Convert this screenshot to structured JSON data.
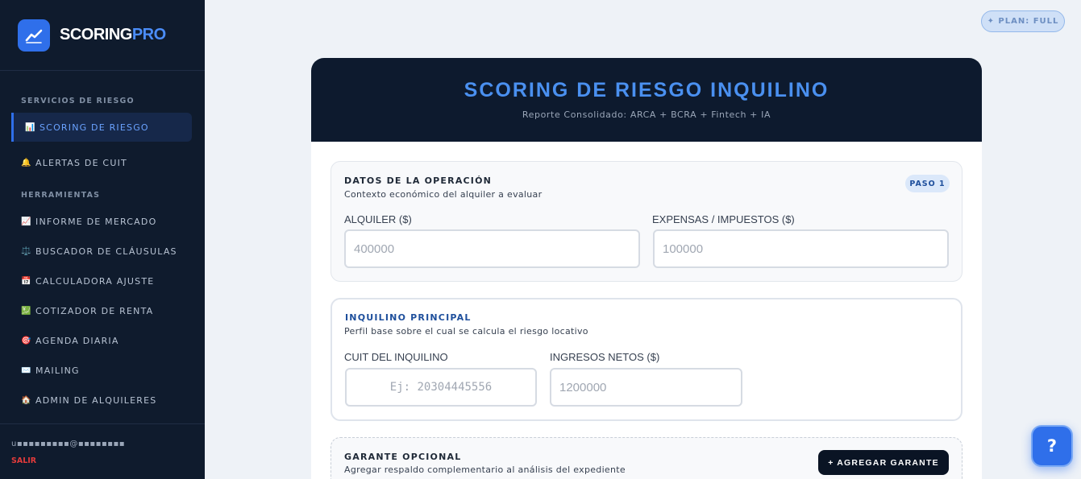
{
  "brand": {
    "name_part1": "SCORING",
    "name_part2": "PRO",
    "icon": "trend-line-icon"
  },
  "sidebar": {
    "section_services": "SERVICIOS DE RIESGO",
    "section_tools": "HERRAMIENTAS",
    "items": [
      {
        "label": "SCORING DE RIESGO",
        "icon": "📊",
        "active": true
      },
      {
        "label": "ALERTAS DE CUIT",
        "icon": "🔔"
      },
      {
        "label": "INFORME DE MERCADO",
        "icon": "📈"
      },
      {
        "label": "BUSCADOR DE CLÁUSULAS",
        "icon": "⚖️"
      },
      {
        "label": "CALCULADORA AJUSTE",
        "icon": "📅"
      },
      {
        "label": "COTIZADOR DE RENTA",
        "icon": "💹"
      },
      {
        "label": "AGENDA DIARIA",
        "icon": "🎯"
      },
      {
        "label": "MAILING",
        "icon": "✉️"
      },
      {
        "label": "ADMIN DE ALQUILERES",
        "icon": "🏠"
      }
    ],
    "footer": {
      "user_email": "u▪▪▪▪▪▪▪▪▪@▪▪▪▪▪▪▪▪",
      "logout": "SALIR"
    }
  },
  "plan_badge": "✦ PLAN: FULL",
  "card": {
    "title": "SCORING DE RIESGO INQUILINO",
    "subtitle": "Reporte Consolidado: ARCA + BCRA + Fintech + IA"
  },
  "operation": {
    "title": "DATOS DE LA OPERACIÓN",
    "description": "Contexto económico del alquiler a evaluar",
    "step": "PASO 1",
    "rent_label": "ALQUILER ($)",
    "rent_placeholder": "400000",
    "expenses_label": "EXPENSAS / IMPUESTOS ($)",
    "expenses_placeholder": "100000"
  },
  "tenant": {
    "title": "INQUILINO PRINCIPAL",
    "description": "Perfil base sobre el cual se calcula el riesgo locativo",
    "cuit_label": "CUIT DEL INQUILINO",
    "cuit_placeholder": "Ej: 20304445556",
    "income_label": "INGRESOS NETOS ($)",
    "income_placeholder": "1200000"
  },
  "guarantor": {
    "title": "GARANTE OPCIONAL",
    "description": "Agregar respaldo complementario al análisis del expediente",
    "add_button": "+ AGREGAR GARANTE"
  },
  "help": {
    "label": "?"
  }
}
